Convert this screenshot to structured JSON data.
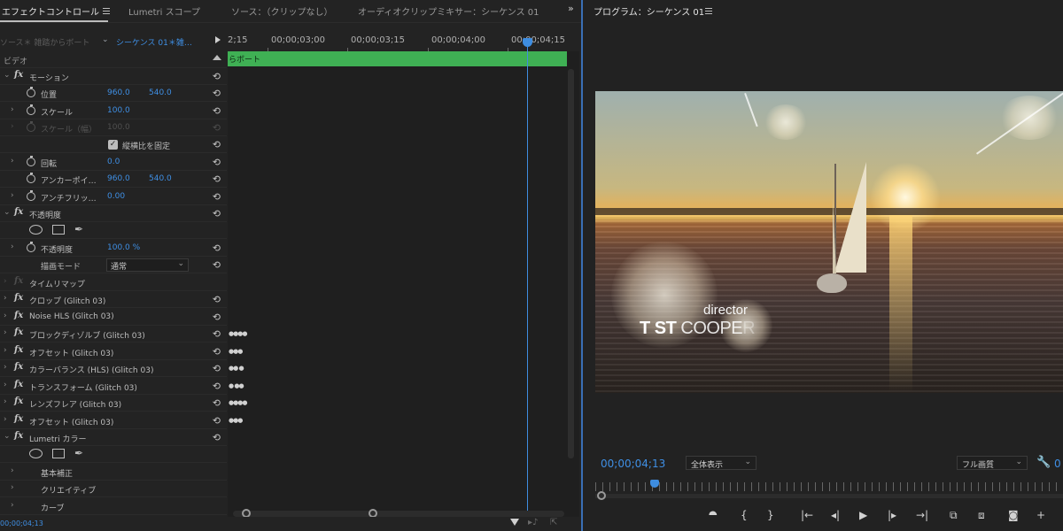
{
  "tabs": {
    "effect_controls": "エフェクトコントロール",
    "lumetri_scopes": "Lumetri スコープ",
    "source": "ソース：（クリップなし）",
    "audio_clip_mixer": "オーディオクリップミキサー：シーケンス 01",
    "program": "プログラム：シーケンス 01"
  },
  "effect_controls": {
    "source_label": "ソース＊ 雑踏からボート",
    "sequence_label": "シーケンス 01＊雑…",
    "section_video": "ビデオ",
    "motion": {
      "label": "モーション",
      "position": {
        "label": "位置",
        "x": "960.0",
        "y": "540.0"
      },
      "scale": {
        "label": "スケール",
        "value": "100.0"
      },
      "scale_width": {
        "label": "スケール（幅）",
        "value": "100.0"
      },
      "uniform_scale": {
        "label": "縦横比を固定",
        "checked": true
      },
      "rotation": {
        "label": "回転",
        "value": "0.0"
      },
      "anchor": {
        "label": "アンカーポイ…",
        "x": "960.0",
        "y": "540.0"
      },
      "anti_flicker": {
        "label": "アンチフリッ…",
        "value": "0.00"
      }
    },
    "opacity": {
      "label": "不透明度",
      "opacity_value": {
        "label": "不透明度",
        "value": "100.0 %"
      },
      "blend_mode": {
        "label": "描画モード",
        "value": "通常"
      }
    },
    "time_remap": "タイムリマップ",
    "effects": [
      "クロップ (Glitch 03)",
      "Noise HLS (Glitch 03)",
      "ブロックディゾルブ (Glitch 03)",
      "オフセット (Glitch 03)",
      "カラーバランス (HLS) (Glitch 03)",
      "トランスフォーム (Glitch 03)",
      "レンズフレア (Glitch 03)",
      "オフセット (Glitch 03)"
    ],
    "lumetri": {
      "label": "Lumetri カラー",
      "sections": [
        "基本補正",
        "クリエイティブ",
        "カーブ"
      ]
    },
    "timecode": "00;00;04;13"
  },
  "timeline": {
    "ruler": [
      "2;15",
      "00;00;03;00",
      "00;00;03;15",
      "00;00;04;00",
      "00;00;04;15"
    ],
    "clip_label": "らボート"
  },
  "program_monitor": {
    "overlay_director": "director",
    "overlay_name_a": "T",
    "overlay_name_b": "ST",
    "overlay_name_c": "COOPE",
    "overlay_name_d": "R",
    "timecode": "00;00;04;13",
    "zoom": "全体表示",
    "quality": "フル画質",
    "end_timecode_partial": "0"
  },
  "colors": {
    "accent_blue": "#3f8fe4",
    "clip_green": "#3fb054",
    "panel_bg": "#232323"
  }
}
